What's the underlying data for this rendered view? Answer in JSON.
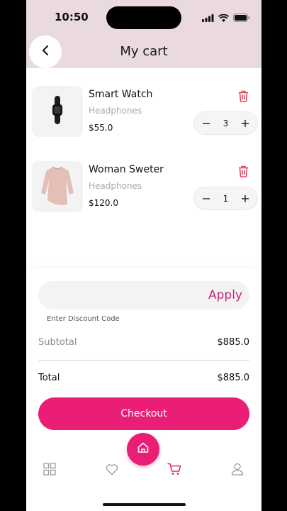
{
  "status_bar": {
    "time": "10:50"
  },
  "header": {
    "title": "My cart"
  },
  "cart_items": [
    {
      "name": "Smart Watch",
      "category": "Headphones",
      "price": "$55.0",
      "quantity": "3"
    },
    {
      "name": "Woman Sweter",
      "category": "Headphones",
      "price": "$120.0",
      "quantity": "1"
    }
  ],
  "discount": {
    "apply_label": "Apply",
    "hint": "Enter Discount Code"
  },
  "summary": {
    "subtotal_label": "Subtotal",
    "subtotal_value": "$885.0",
    "total_label": "Total",
    "total_value": "$885.0"
  },
  "checkout_label": "Checkout",
  "colors": {
    "accent": "#e91e74",
    "apply": "#c42b7c",
    "header_bg": "#ead9e1",
    "trash": "#e0455b"
  },
  "nav": {
    "active": "cart"
  }
}
